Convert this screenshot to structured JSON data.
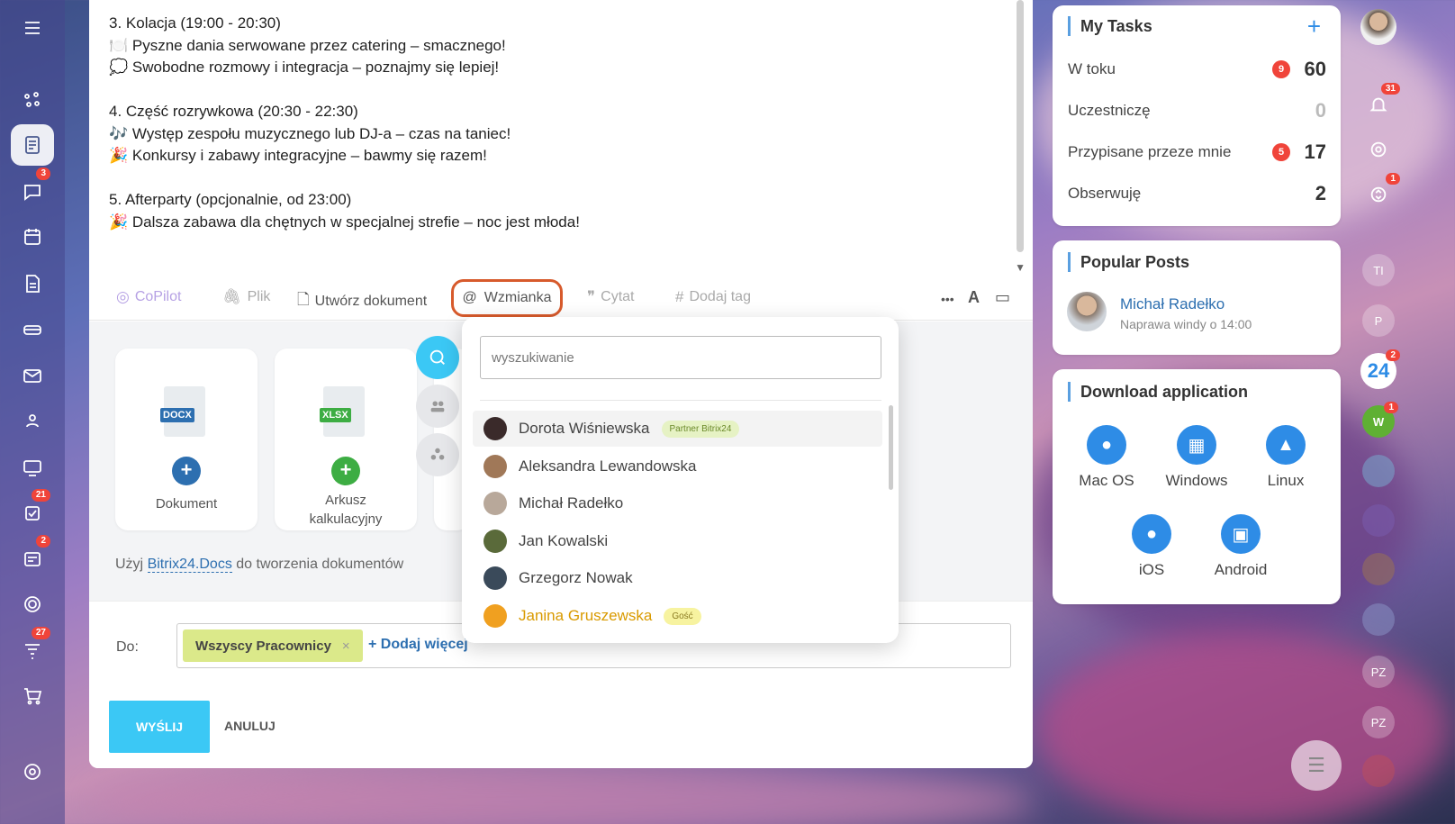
{
  "feed_text": {
    "lines": [
      "3. Kolacja (19:00 - 20:30)",
      "🍽️ Pyszne dania serwowane przez catering – smacznego!",
      "💭 Swobodne rozmowy i integracja – poznajmy się lepiej!",
      "",
      "4. Część rozrywkowa (20:30 - 22:30)",
      "🎶 Występ zespołu muzycznego lub DJ-a – czas na taniec!",
      "🎉 Konkursy i zabawy integracyjne – bawmy się razem!",
      "",
      "5. Afterparty (opcjonalnie, od 23:00)",
      "🎉 Dalsza zabawa dla chętnych w specjalnej strefie – noc jest młoda!"
    ]
  },
  "toolbar": {
    "copilot": "CoPilot",
    "file": "Plik",
    "create_doc": "Utwórz dokument",
    "mention": "Wzmianka",
    "quote": "Cytat",
    "add_tag": "Dodaj tag",
    "more": "•••",
    "font": "A"
  },
  "docs": {
    "doc_label": "Dokument",
    "doc_tag": "DOCX",
    "sheet_label": "Arkusz kalkulacyjny",
    "sheet_tag": "XLSX",
    "hint_prefix": "Użyj ",
    "hint_link": "Bitrix24.Docs",
    "hint_suffix": " do tworzenia dokumentów"
  },
  "recipients": {
    "label": "Do:",
    "chip": "Wszyscy Pracownicy",
    "chip_remove": "×",
    "add_more": "+ Dodaj więcej"
  },
  "actions": {
    "send": "WYŚLIJ",
    "cancel": "ANULUJ"
  },
  "mention_popup": {
    "search_placeholder": "wyszukiwanie",
    "people": [
      {
        "name": "Dorota Wiśniewska",
        "tag": "Partner Bitrix24"
      },
      {
        "name": "Aleksandra Lewandowska",
        "tag": ""
      },
      {
        "name": "Michał Radełko",
        "tag": ""
      },
      {
        "name": "Jan Kowalski",
        "tag": ""
      },
      {
        "name": "Grzegorz Nowak",
        "tag": ""
      },
      {
        "name": "Janina Gruszewska",
        "tag": "Gość"
      }
    ]
  },
  "my_tasks": {
    "title": "My Tasks",
    "add": "+",
    "rows": [
      {
        "label": "W toku",
        "badge": "9",
        "count": "60"
      },
      {
        "label": "Uczestniczę",
        "badge": "",
        "count": "0"
      },
      {
        "label": "Przypisane przeze mnie",
        "badge": "5",
        "count": "17"
      },
      {
        "label": "Obserwuję",
        "badge": "",
        "count": "2"
      }
    ]
  },
  "popular_posts": {
    "title": "Popular Posts",
    "author": "Michał Radełko",
    "subtitle": "Naprawa windy o 14:00"
  },
  "download": {
    "title": "Download application",
    "apps": [
      "Mac OS",
      "Windows",
      "Linux",
      "iOS",
      "Android"
    ]
  },
  "left_badges": {
    "chat": "3",
    "tasks": "21",
    "news": "2",
    "feed": "27"
  },
  "right_badges": {
    "bell": "31",
    "sync": "1",
    "b24": "2",
    "w": "1"
  },
  "right_labels": {
    "b24": "24",
    "w": "W",
    "ti": "TI",
    "p": "P",
    "pz1": "PZ",
    "pz2": "PZ"
  },
  "colors": {
    "accent": "#3bc8f5",
    "link": "#2d6fb0",
    "badge": "#f0443a",
    "mention_border": "#d75a2c"
  }
}
